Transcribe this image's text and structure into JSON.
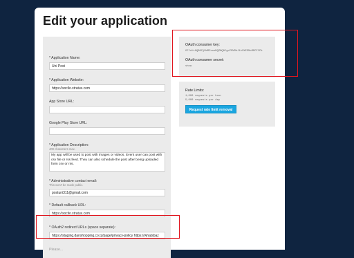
{
  "page": {
    "title": "Edit your application"
  },
  "form": {
    "app_name": {
      "label": "* Application Name:",
      "value": "Uni Post"
    },
    "website": {
      "label": "* Application Website:",
      "value": "https://socllo.stratux.com"
    },
    "app_store": {
      "label": "App Store URL:",
      "value": ""
    },
    "play_store": {
      "label": "Google Play Store URL:",
      "value": ""
    },
    "description": {
      "label": "* Application Description:",
      "hint": "400 characters max.",
      "value": "My app will be used to post with images or videos. Event user can post with csv file or rss feed. They can also schedule the post after being uploaded form csv or rss."
    },
    "contact_email": {
      "label": "* Administrative contact email:",
      "hint": "This won't be made public.",
      "value": "postuni311@gmail.com"
    },
    "callback_url": {
      "label": "* Default callback URL:",
      "value": "https://socllo.stratux.com"
    },
    "redirect_urls": {
      "label": "* OAuth2 redirect URLs (space separate):",
      "value": "https://staging.danshopping.co.tz/page/privacy-policy https://whatsbaz"
    },
    "cutoff_label": "Please..."
  },
  "oauth": {
    "key_label": "OAuth consumer key:",
    "key_value": "O7fcUrAQB9ZjMdRZoseBQZNQ8fgcPMVRbJ1kXXEEMoRRCFCPk",
    "secret_label": "OAuth consumer secret:",
    "secret_value": "show"
  },
  "rate_limits": {
    "title": "Rate Limits:",
    "per_hour": "1,000 requests per hour",
    "per_day": "5,000 requests per day",
    "button_label": "Request rate limit removal"
  },
  "colors": {
    "background": "#0f2440",
    "panel": "#ebebeb",
    "accent_button": "#1aa6e0",
    "highlight": "#e0161f"
  }
}
